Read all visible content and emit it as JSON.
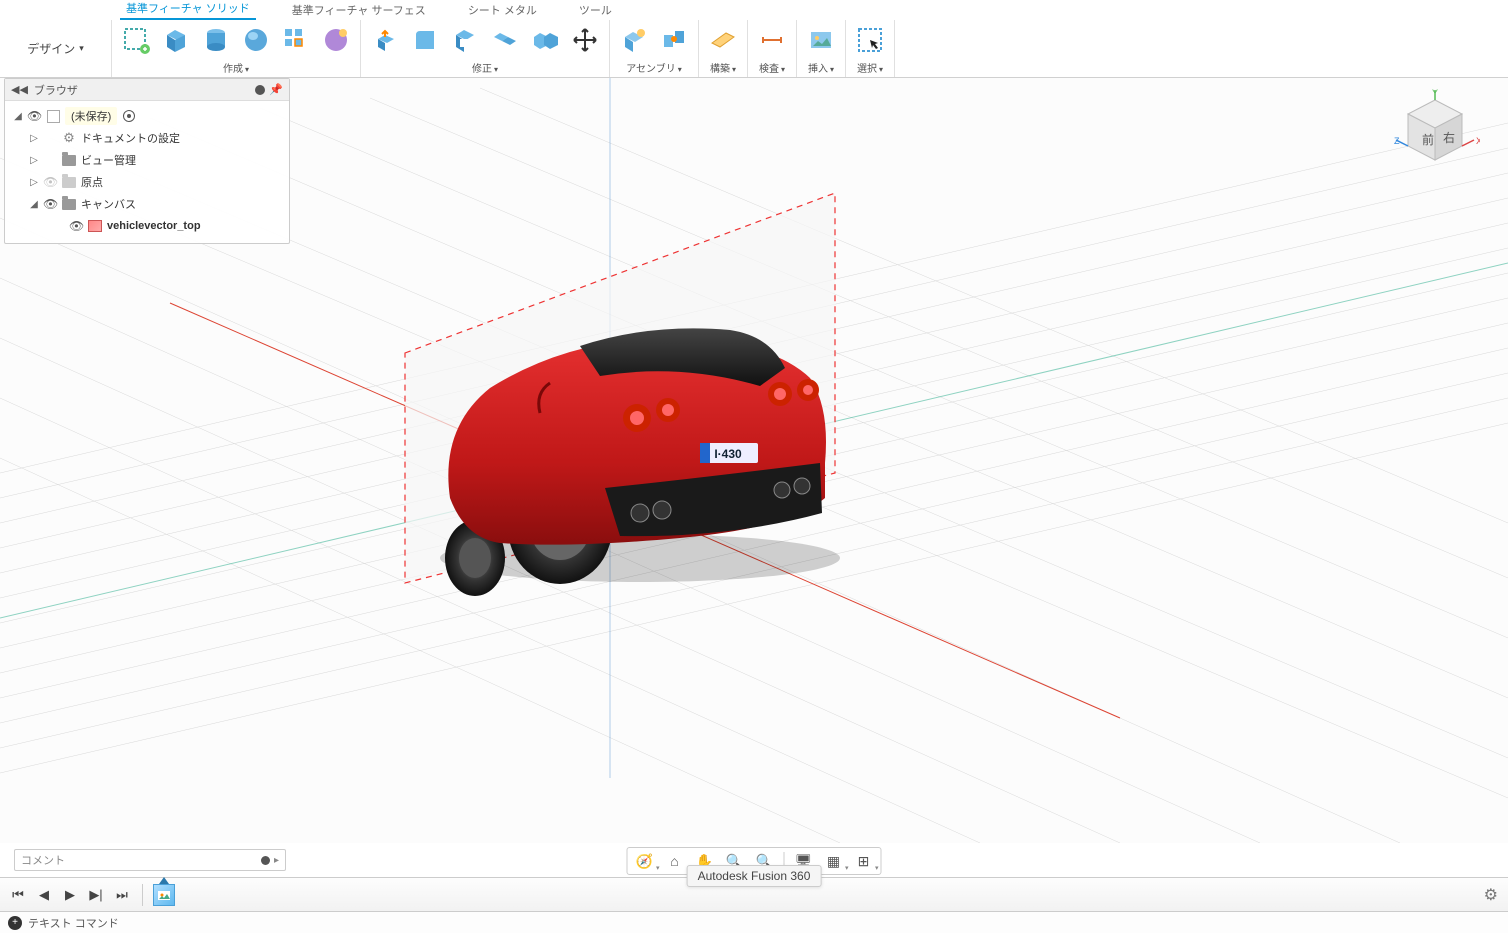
{
  "tabs": {
    "solid": "基準フィーチャ ソリッド",
    "surface": "基準フィーチャ サーフェス",
    "sheetmetal": "シート メタル",
    "tool": "ツール"
  },
  "workspace": {
    "design": "デザイン"
  },
  "ribbon": {
    "create": "作成",
    "modify": "修正",
    "assembly": "アセンブリ",
    "construct": "構築",
    "inspect": "検査",
    "insert": "挿入",
    "select": "選択"
  },
  "browser": {
    "title": "ブラウザ",
    "root": "(未保存)",
    "docset": "ドキュメントの設定",
    "viewmgr": "ビュー管理",
    "origin": "原点",
    "canvases": "キャンバス",
    "canvas_item": "vehiclevector_top"
  },
  "viewcube": {
    "front": "前",
    "right": "右",
    "x": "X",
    "y": "Y",
    "z": "Z"
  },
  "comments": {
    "placeholder": "コメント"
  },
  "status": {
    "textcmd": "テキスト コマンド"
  },
  "tooltip": {
    "app": "Autodesk Fusion 360"
  },
  "canvas_image": {
    "plate": "I·430"
  }
}
